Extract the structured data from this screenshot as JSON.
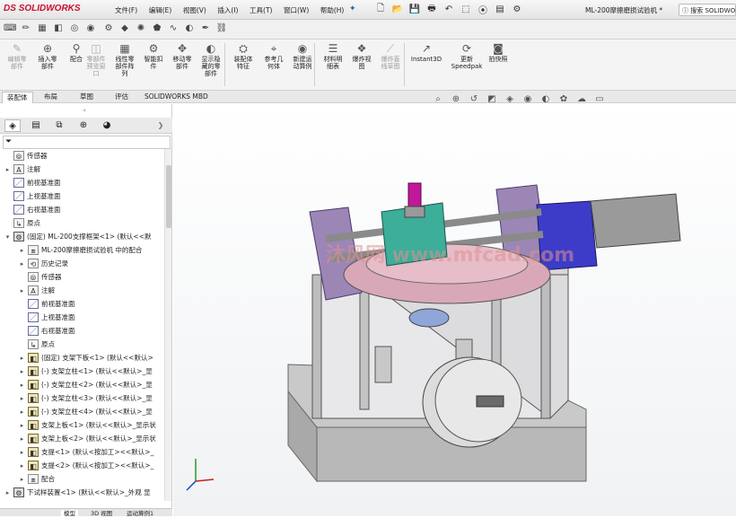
{
  "app": {
    "logo": "SOLIDWORKS",
    "logo_prefix": "DS",
    "doc_title": "ML-200摩擦磨损试验机 *",
    "help_search": "搜索 SOLIDWO"
  },
  "menu": [
    "文件(F)",
    "编辑(E)",
    "视图(V)",
    "插入(I)",
    "工具(T)",
    "窗口(W)",
    "帮助(H)"
  ],
  "ribbon": [
    {
      "label": "编辑零\n部件",
      "disabled": true,
      "icon": "✎"
    },
    {
      "label": "插入零\n部件",
      "disabled": false,
      "icon": "⊕"
    },
    {
      "label": "配合",
      "disabled": false,
      "icon": "⚲"
    },
    {
      "label": "零部件\n预览窗\n口",
      "disabled": true,
      "icon": "◫"
    },
    {
      "label": "线性零\n部件阵\n列",
      "disabled": false,
      "icon": "▦"
    },
    {
      "label": "智能扣\n件",
      "disabled": false,
      "icon": "⚙"
    },
    {
      "label": "移动零\n部件",
      "disabled": false,
      "icon": "✥"
    },
    {
      "label": "显示隐\n藏的零\n部件",
      "disabled": false,
      "icon": "◐"
    },
    {
      "label": "装配体\n特征",
      "disabled": false,
      "icon": "⛭"
    },
    {
      "label": "参考几\n何体",
      "disabled": false,
      "icon": "⌖"
    },
    {
      "label": "新建运\n动算例",
      "disabled": false,
      "icon": "◉"
    },
    {
      "label": "材料明\n细表",
      "disabled": false,
      "icon": "☰"
    },
    {
      "label": "爆炸视\n图",
      "disabled": false,
      "icon": "❖"
    },
    {
      "label": "爆炸直\n线草图",
      "disabled": true,
      "icon": "⟋"
    },
    {
      "label": "Instant3D",
      "disabled": false,
      "icon": "↗"
    },
    {
      "label": "更新\nSpeedpak",
      "disabled": false,
      "icon": "⟳"
    },
    {
      "label": "拍快照",
      "disabled": false,
      "icon": "◙"
    }
  ],
  "tabs": [
    "装配体",
    "布局",
    "草图",
    "评估",
    "SOLIDWORKS MBD"
  ],
  "tree": [
    {
      "level": 0,
      "arrow": "",
      "icon": "sensor",
      "text": "传感器"
    },
    {
      "level": 0,
      "arrow": "▸",
      "icon": "note",
      "text": "注解"
    },
    {
      "level": 0,
      "arrow": "",
      "icon": "plane",
      "text": "前视基准面"
    },
    {
      "level": 0,
      "arrow": "",
      "icon": "plane",
      "text": "上视基准面"
    },
    {
      "level": 0,
      "arrow": "",
      "icon": "plane",
      "text": "右视基准面"
    },
    {
      "level": 0,
      "arrow": "",
      "icon": "origin",
      "text": "原点"
    },
    {
      "level": 0,
      "arrow": "▾",
      "icon": "assy",
      "text": "(固定) ML-200支撑框架<1> (默认<<默"
    },
    {
      "level": 1,
      "arrow": "▸",
      "icon": "mate",
      "text": "ML-200摩擦磨损试验机 中的配合"
    },
    {
      "level": 1,
      "arrow": "▸",
      "icon": "history",
      "text": "历史记录"
    },
    {
      "level": 1,
      "arrow": "",
      "icon": "sensor",
      "text": "传感器"
    },
    {
      "level": 1,
      "arrow": "▸",
      "icon": "note",
      "text": "注解"
    },
    {
      "level": 1,
      "arrow": "",
      "icon": "plane",
      "text": "前视基准面"
    },
    {
      "level": 1,
      "arrow": "",
      "icon": "plane",
      "text": "上视基准面"
    },
    {
      "level": 1,
      "arrow": "",
      "icon": "plane",
      "text": "右视基准面"
    },
    {
      "level": 1,
      "arrow": "",
      "icon": "origin",
      "text": "原点"
    },
    {
      "level": 1,
      "arrow": "▸",
      "icon": "part",
      "text": "(固定) 支架下板<1> (默认<<默认>"
    },
    {
      "level": 1,
      "arrow": "▸",
      "icon": "part",
      "text": "(-) 支架立柱<1> (默认<<默认>_显"
    },
    {
      "level": 1,
      "arrow": "▸",
      "icon": "part",
      "text": "(-) 支架立柱<2> (默认<<默认>_显"
    },
    {
      "level": 1,
      "arrow": "▸",
      "icon": "part",
      "text": "(-) 支架立柱<3> (默认<<默认>_显"
    },
    {
      "level": 1,
      "arrow": "▸",
      "icon": "part",
      "text": "(-) 支架立柱<4> (默认<<默认>_显"
    },
    {
      "level": 1,
      "arrow": "▸",
      "icon": "part",
      "text": "支架上板<1> (默认<<默认>_显示状"
    },
    {
      "level": 1,
      "arrow": "▸",
      "icon": "part",
      "text": "支架上板<2> (默认<<默认>_显示状"
    },
    {
      "level": 1,
      "arrow": "▸",
      "icon": "part",
      "text": "支提<1> (默认<按加工><<默认>_"
    },
    {
      "level": 1,
      "arrow": "▸",
      "icon": "part",
      "text": "支提<2> (默认<按加工><<默认>_"
    },
    {
      "level": 1,
      "arrow": "▸",
      "icon": "mate",
      "text": "配合"
    },
    {
      "level": 0,
      "arrow": "▸",
      "icon": "assy",
      "text": "下试样装置<1> (默认<<默认>_外观 显"
    }
  ],
  "bottom_tabs": [
    "模型",
    "3D 视图",
    "运动算例1"
  ],
  "watermark": "沐风网 www.mfcad.com",
  "colors": {
    "accent": "#c8102e",
    "frame_purple": "#9b86b6",
    "motor_blue": "#3c3cc8",
    "disc_pink": "#d8a8b8",
    "magenta": "#c01898"
  }
}
